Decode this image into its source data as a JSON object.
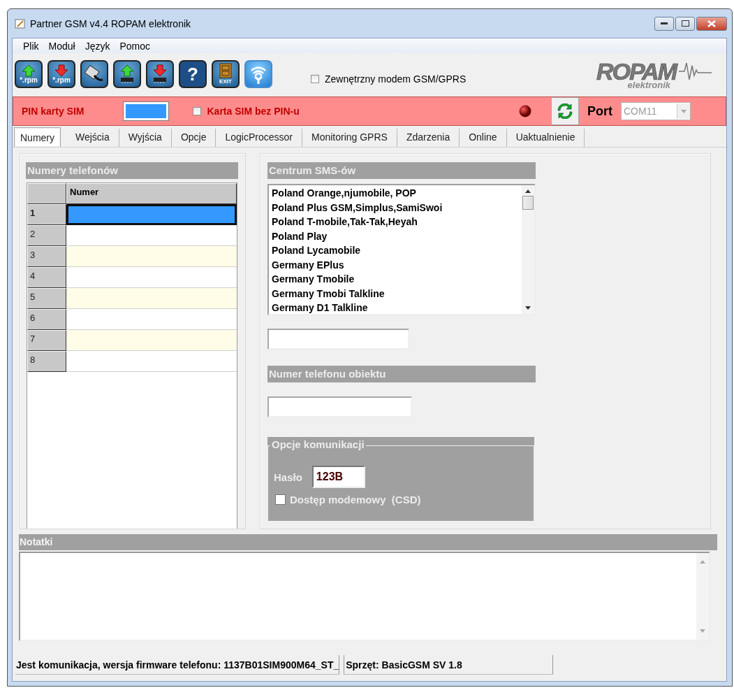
{
  "window": {
    "title": "Partner GSM v4.4 ROPAM elektronik"
  },
  "menu": [
    "Plik",
    "Moduł",
    "Język",
    "Pomoc"
  ],
  "toolbar": [
    {
      "kind": "upload-file",
      "caption": "*.rpm"
    },
    {
      "kind": "download-file",
      "caption": "*.rpm"
    },
    {
      "kind": "cable"
    },
    {
      "kind": "upload-chip"
    },
    {
      "kind": "download-chip"
    },
    {
      "kind": "help",
      "caption": "?"
    },
    {
      "kind": "exit",
      "caption": "EXIT"
    },
    {
      "kind": "wireless"
    }
  ],
  "external_modem": {
    "label": "Zewnętrzny modem GSM/GPRS",
    "checked": false
  },
  "logo": {
    "name": "ROPAM",
    "sub": "elektronik"
  },
  "sim_bar": {
    "pin_label": "PIN karty SIM",
    "no_pin": {
      "label": "Karta SIM bez PIN-u",
      "checked": false
    },
    "port_label": "Port",
    "port": {
      "value": "COM11",
      "disabled": true
    }
  },
  "tabs": [
    {
      "label": "Numery",
      "selected": true
    },
    {
      "label": "Wejścia",
      "selected": false
    },
    {
      "label": "Wyjścia",
      "selected": false
    },
    {
      "label": "Opcje",
      "selected": false
    },
    {
      "label": "LogicProcessor",
      "selected": false
    },
    {
      "label": "Monitoring GPRS",
      "selected": false
    },
    {
      "label": "Zdarzenia",
      "selected": false
    },
    {
      "label": "Online",
      "selected": false
    },
    {
      "label": "Uaktualnienie",
      "selected": false
    }
  ],
  "phone_numbers": {
    "title": "Numery telefonów",
    "column": "Numer",
    "rows": [
      {
        "label": "1",
        "selected": true
      },
      {
        "label": "2",
        "selected": false
      },
      {
        "label": "3",
        "selected": false
      },
      {
        "label": "4",
        "selected": false
      },
      {
        "label": "5",
        "selected": false
      },
      {
        "label": "6",
        "selected": false
      },
      {
        "label": "7",
        "selected": false
      },
      {
        "label": "8",
        "selected": false
      }
    ]
  },
  "sms_center": {
    "title": "Centrum SMS-ów",
    "items": [
      "Poland Orange,njumobile, POP",
      "Poland Plus GSM,Simplus,SamiSwoi",
      "Poland T-mobile,Tak-Tak,Heyah",
      "Poland Play",
      "Poland Lycamobile",
      "Germany EPlus",
      "Germany Tmobile",
      "Germany Tmobi Talkline",
      "Germany D1 Talkline"
    ]
  },
  "object_phone": {
    "title": "Numer telefonu obiektu"
  },
  "comm_options": {
    "title": "Opcje komunikacji",
    "password_label": "Hasło",
    "password": "123B",
    "modem_access": {
      "label": "Dostęp modemowy  (CSD)",
      "checked": false
    }
  },
  "notes": {
    "title": "Notatki"
  },
  "status_bar": [
    "Jest komunikacja, wersja firmware telefonu: 1137B01SIM900M64_ST_",
    "Sprzęt: BasicGSM SV 1.8"
  ]
}
